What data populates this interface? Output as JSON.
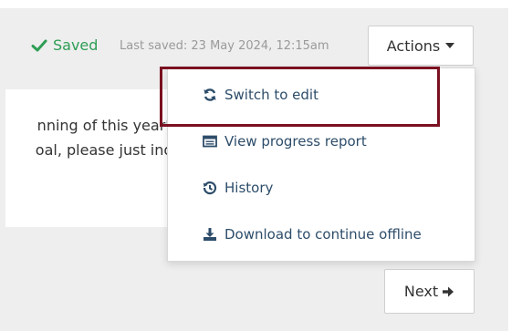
{
  "header": {
    "saved_status": "Saved",
    "last_saved": "Last saved: 23 May 2024, 12:15am",
    "actions_label": "Actions"
  },
  "content": {
    "line1": "nning of this year's",
    "line2": "oal, please just indi"
  },
  "actions_menu": {
    "items": [
      {
        "label": "Switch to edit",
        "icon": "refresh-icon"
      },
      {
        "label": "View progress report",
        "icon": "report-icon"
      },
      {
        "label": "History",
        "icon": "history-icon"
      },
      {
        "label": "Download to continue offline",
        "icon": "download-icon"
      }
    ]
  },
  "footer": {
    "next_label": "Next"
  },
  "colors": {
    "saved_green": "#2e9e55",
    "menu_text": "#2d4d6a",
    "highlight": "#7a1020",
    "background": "#eeeeee"
  }
}
